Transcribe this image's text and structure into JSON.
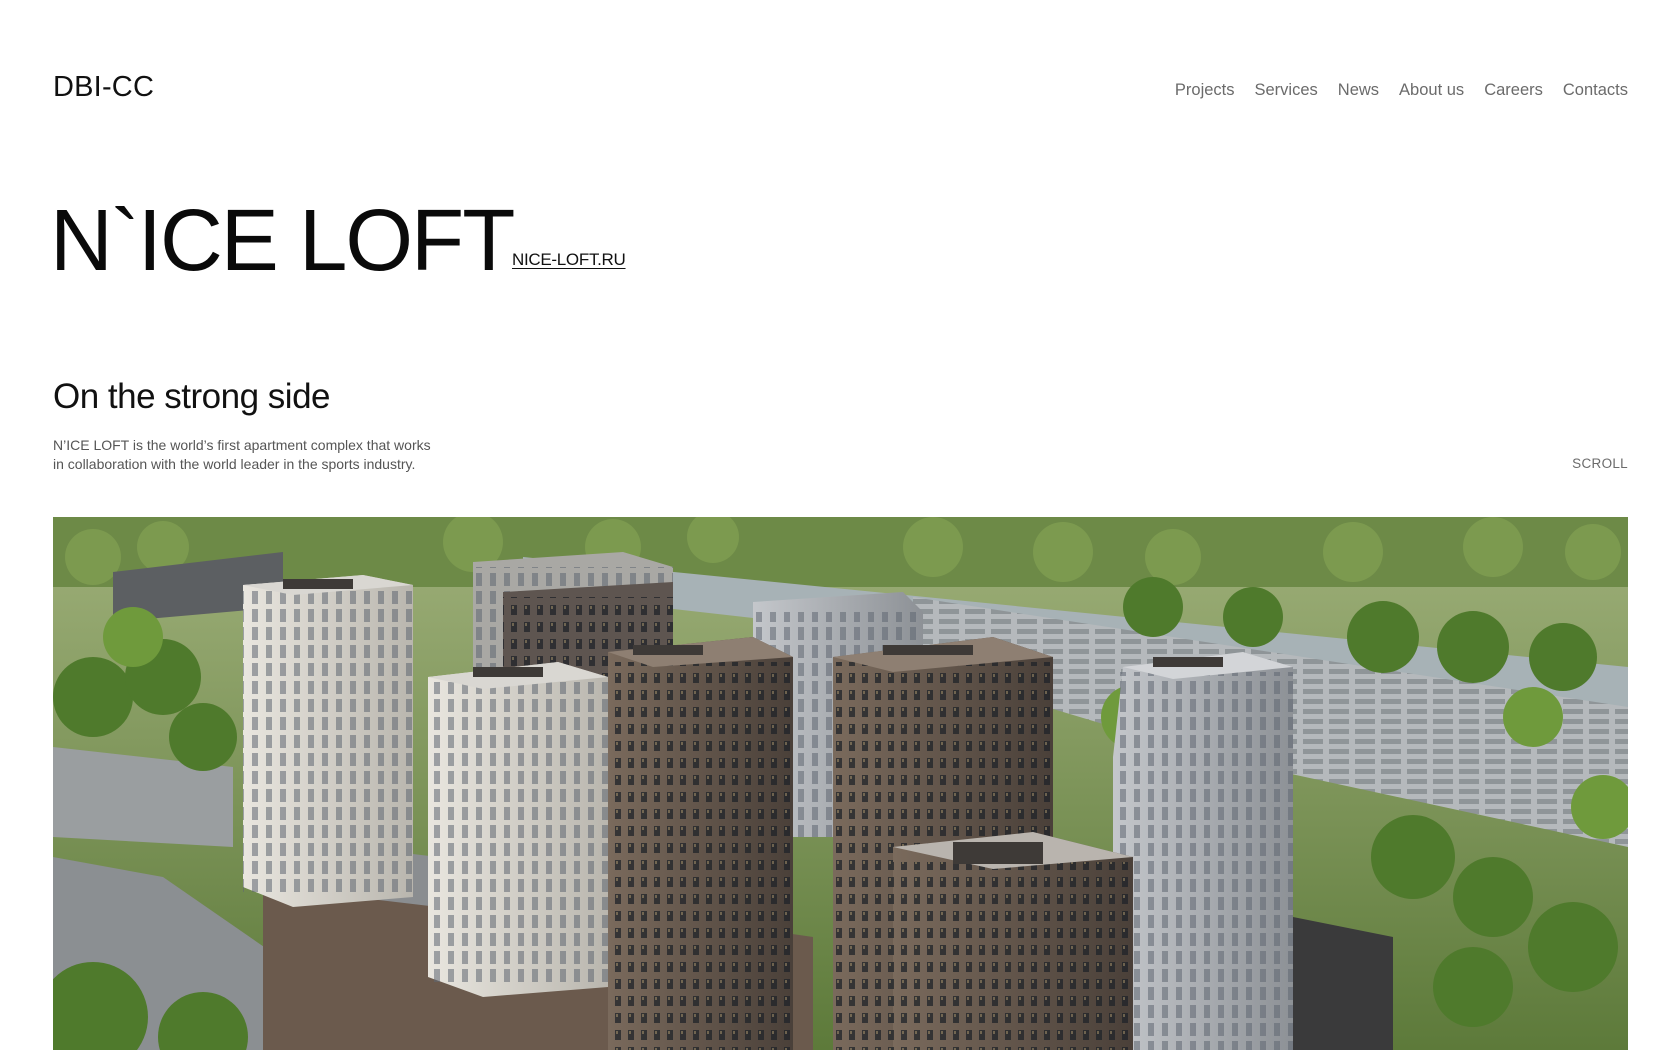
{
  "header": {
    "logo": "DBI-CC",
    "nav": [
      {
        "label": "Projects"
      },
      {
        "label": "Services"
      },
      {
        "label": "News"
      },
      {
        "label": "About us"
      },
      {
        "label": "Careers"
      },
      {
        "label": "Contacts"
      }
    ]
  },
  "project": {
    "title": "N`ICE LOFT",
    "site_link": "NICE-LOFT.RU",
    "subtitle": "On the strong side",
    "description": [
      "N’ICE LOFT is the world’s first apartment complex that works",
      "in collaboration with the world leader in the sports industry."
    ],
    "scroll_label": "SCROLL"
  },
  "colors": {
    "text": "#111111",
    "nav_text": "#6b6b6b",
    "background": "#ffffff"
  }
}
